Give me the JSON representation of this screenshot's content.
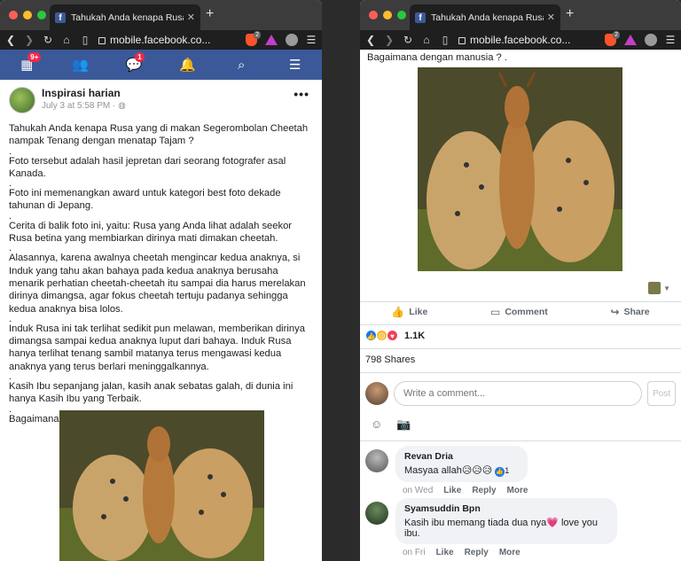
{
  "browser": {
    "tab_title": "Tahukah Anda kenapa Rusa yang",
    "url": "mobile.facebook.co...",
    "brave_count": "2",
    "favicon": "f"
  },
  "fb_nav": {
    "home_badge": "9+",
    "messenger_badge": "1",
    "icons": [
      "home-icon",
      "friends-icon",
      "messenger-icon",
      "bell-icon",
      "search-icon",
      "menu-icon"
    ]
  },
  "post": {
    "author": "Inspirasi harian",
    "date": "July 3 at 5:58 PM · ",
    "privacy_icon": "globe-icon",
    "paragraphs": [
      "Tahukah Anda kenapa Rusa yang di makan Segerombolan Cheetah nampak Tenang dengan menatap Tajam ?",
      ".",
      "Foto tersebut adalah hasil jepretan dari seorang fotografer asal Kanada.",
      ".",
      "Foto ini memenangkan award untuk kategori best foto dekade tahunan di Jepang.",
      ".",
      "Cerita di balik foto ini, yaitu: Rusa yang Anda lihat adalah seekor Rusa betina yang membiarkan dirinya mati dimakan cheetah.",
      ".",
      "Alasannya, karena awalnya cheetah mengincar kedua anaknya, si Induk yang tahu akan bahaya pada kedua anaknya berusaha menarik perhatian cheetah-cheetah itu sampai dia harus merelakan dirinya dimangsa, agar fokus cheetah tertuju padanya sehingga kedua anaknya bisa lolos.",
      ".",
      "Induk Rusa ini tak terlihat sedikit pun melawan, memberikan dirinya dimangsa sampai kedua anaknya luput dari bahaya. Induk Rusa hanya terlihat tenang sambil matanya terus mengawasi kedua anaknya yang terus berlari meninggalkannya.",
      ".",
      "Kasih Ibu sepanjang jalan, kasih anak sebatas galah, di dunia ini hanya Kasih Ibu yang Terbaik.",
      ".",
      "Bagaimana dengan manusia ? ."
    ]
  },
  "right": {
    "closing_line": "Bagaimana dengan manusia ? .",
    "actions": {
      "like": "Like",
      "comment": "Comment",
      "share": "Share"
    },
    "reaction_count": "1.1K",
    "shares": "798 Shares",
    "comment_placeholder": "Write a comment...",
    "post_button": "Post",
    "comments": [
      {
        "name": "Revan Dria",
        "text": "Masyaa allah😥😥😥",
        "like_count": "1",
        "time": "on Wed",
        "like": "Like",
        "reply": "Reply",
        "more": "More"
      },
      {
        "name": "Syamsuddin Bpn",
        "text": "Kasih ibu memang tiada dua nya💗 love you ibu.",
        "time": "on Fri",
        "like": "Like",
        "reply": "Reply",
        "more": "More"
      }
    ]
  }
}
